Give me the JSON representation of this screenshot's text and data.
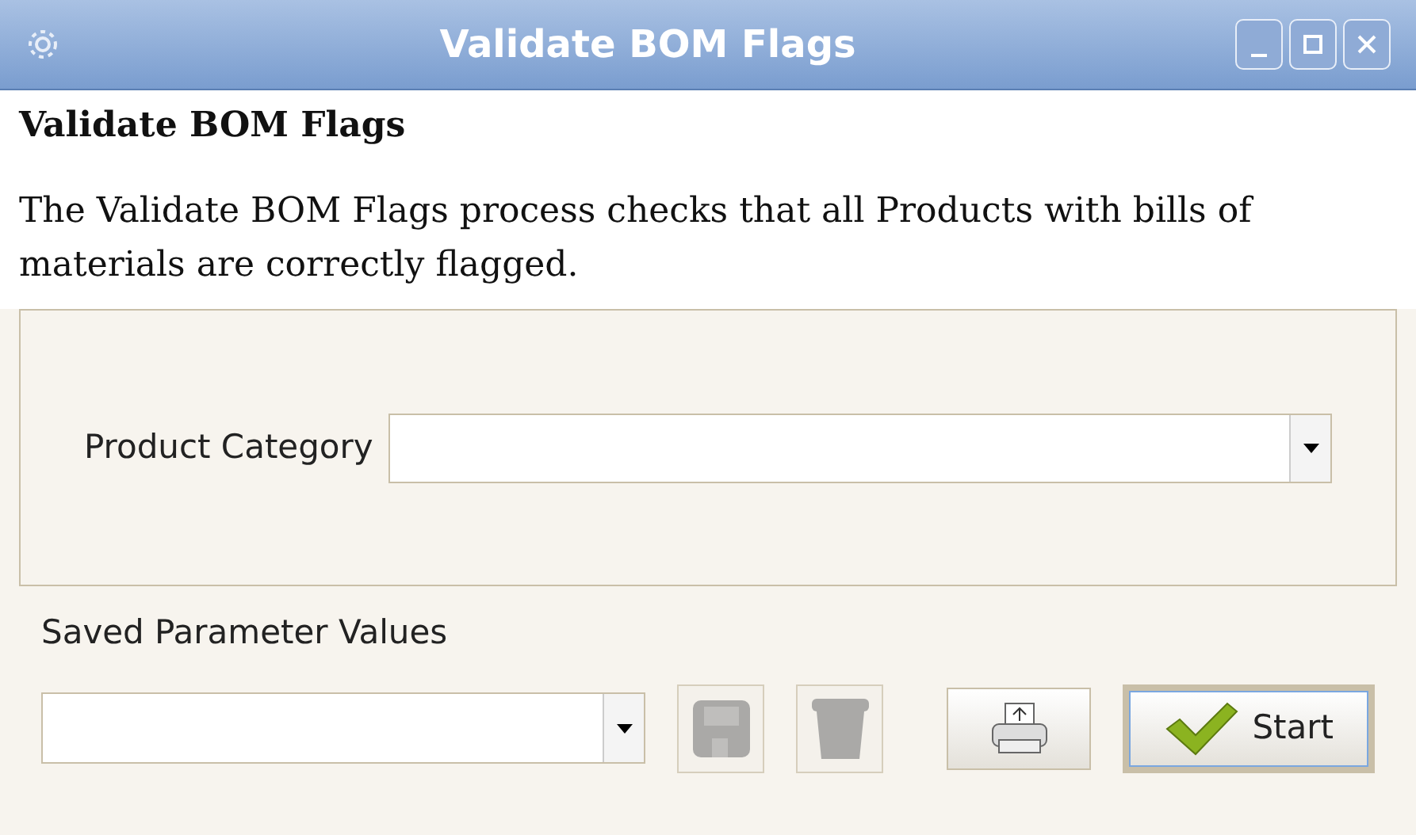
{
  "window": {
    "title": "Validate BOM Flags"
  },
  "heading": "Validate BOM Flags",
  "description": "The Validate BOM Flags process checks that all Products with bills of materials are correctly flagged.",
  "parameters": [
    {
      "label": "Product Category"
    }
  ],
  "saved_parameters": {
    "label": "Saved Parameter Values"
  },
  "actions": [
    {
      "kind": "save",
      "disabled": true
    },
    {
      "kind": "delete",
      "disabled": true
    },
    {
      "kind": "print",
      "disabled": false
    },
    {
      "kind": "start",
      "label": "Start",
      "disabled": false
    }
  ]
}
